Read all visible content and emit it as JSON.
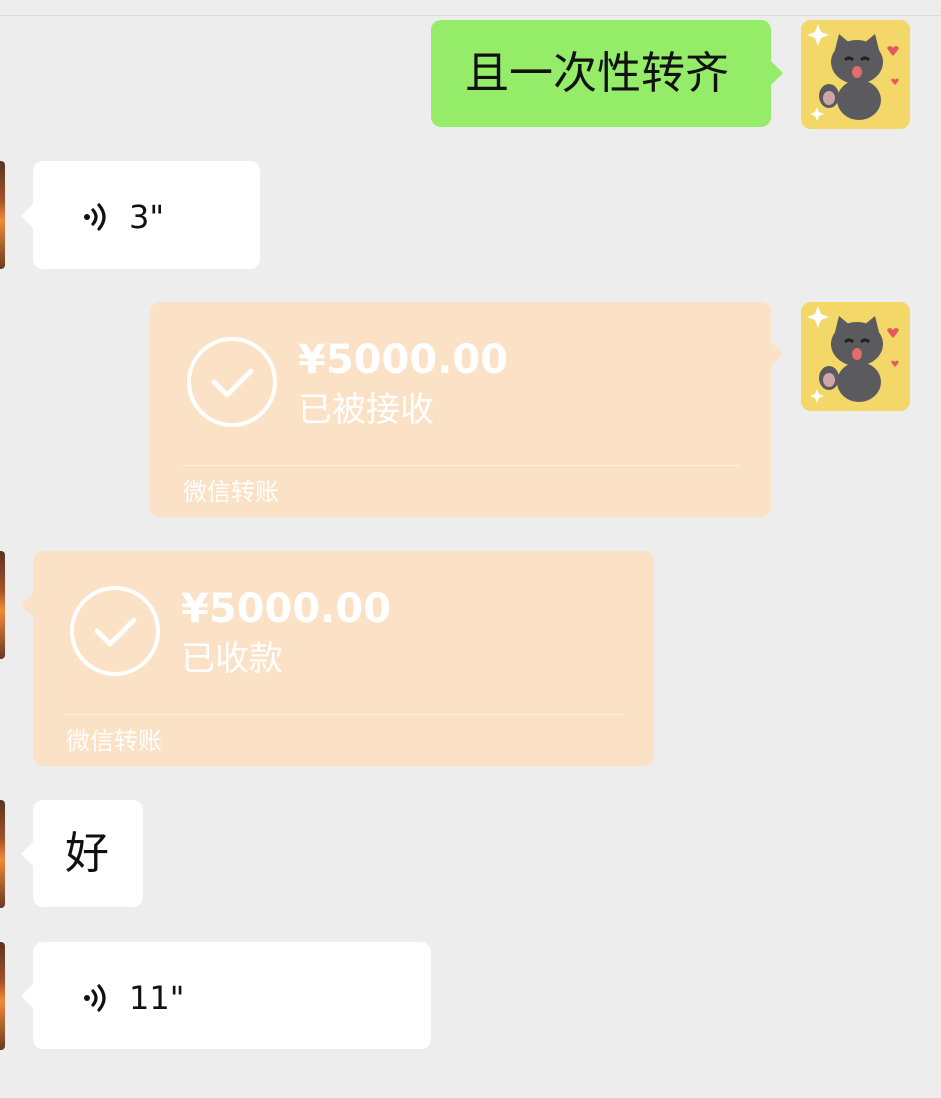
{
  "messages": [
    {
      "side": "right",
      "type": "text",
      "text": "且一次性转齐"
    },
    {
      "side": "left",
      "type": "voice",
      "duration": "3\""
    },
    {
      "side": "right",
      "type": "transfer",
      "amount": "¥5000.00",
      "status": "已被接收",
      "footer": "微信转账"
    },
    {
      "side": "left",
      "type": "transfer",
      "amount": "¥5000.00",
      "status": "已收款",
      "footer": "微信转账"
    },
    {
      "side": "left",
      "type": "text",
      "text": "好"
    },
    {
      "side": "left",
      "type": "voice",
      "duration": "11\""
    }
  ],
  "colors": {
    "background": "#ededed",
    "sent_bubble": "#95ec69",
    "received_bubble": "#ffffff",
    "transfer_bubble": "#fbe1c5"
  },
  "icons": {
    "avatar_right": "cartoon-cat-avatar",
    "voice": "voice-wave-icon",
    "transfer_check": "check-circle-icon"
  }
}
